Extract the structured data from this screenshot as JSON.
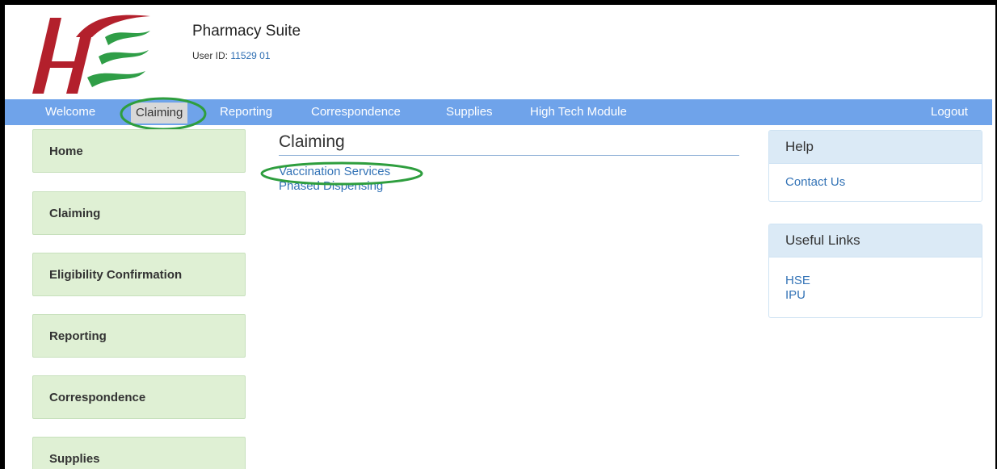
{
  "header": {
    "app_title": "Pharmacy Suite",
    "user_label": "User ID:",
    "user_id": "11529 01"
  },
  "nav": {
    "welcome": "Welcome",
    "claiming": "Claiming",
    "reporting": "Reporting",
    "correspondence": "Correspondence",
    "supplies": "Supplies",
    "high_tech": "High Tech Module",
    "logout": "Logout"
  },
  "sidebar": {
    "items": [
      {
        "label": "Home"
      },
      {
        "label": "Claiming"
      },
      {
        "label": "Eligibility Confirmation"
      },
      {
        "label": "Reporting"
      },
      {
        "label": "Correspondence"
      },
      {
        "label": "Supplies"
      }
    ]
  },
  "main": {
    "title": "Claiming",
    "links": [
      {
        "label": "Vaccination Services"
      },
      {
        "label": "Phased Dispensing"
      }
    ]
  },
  "help_panel": {
    "title": "Help",
    "links": [
      {
        "label": "Contact Us"
      }
    ]
  },
  "useful_links_panel": {
    "title": "Useful Links",
    "links": [
      {
        "label": "HSE"
      },
      {
        "label": "IPU"
      }
    ]
  },
  "colors": {
    "nav_bg": "#6fa3ea",
    "sidebar_bg": "#dff0d4",
    "link": "#3373b6",
    "annotation": "#2e9e3e",
    "logo_red": "#b3202c",
    "logo_green": "#2f9e47"
  }
}
